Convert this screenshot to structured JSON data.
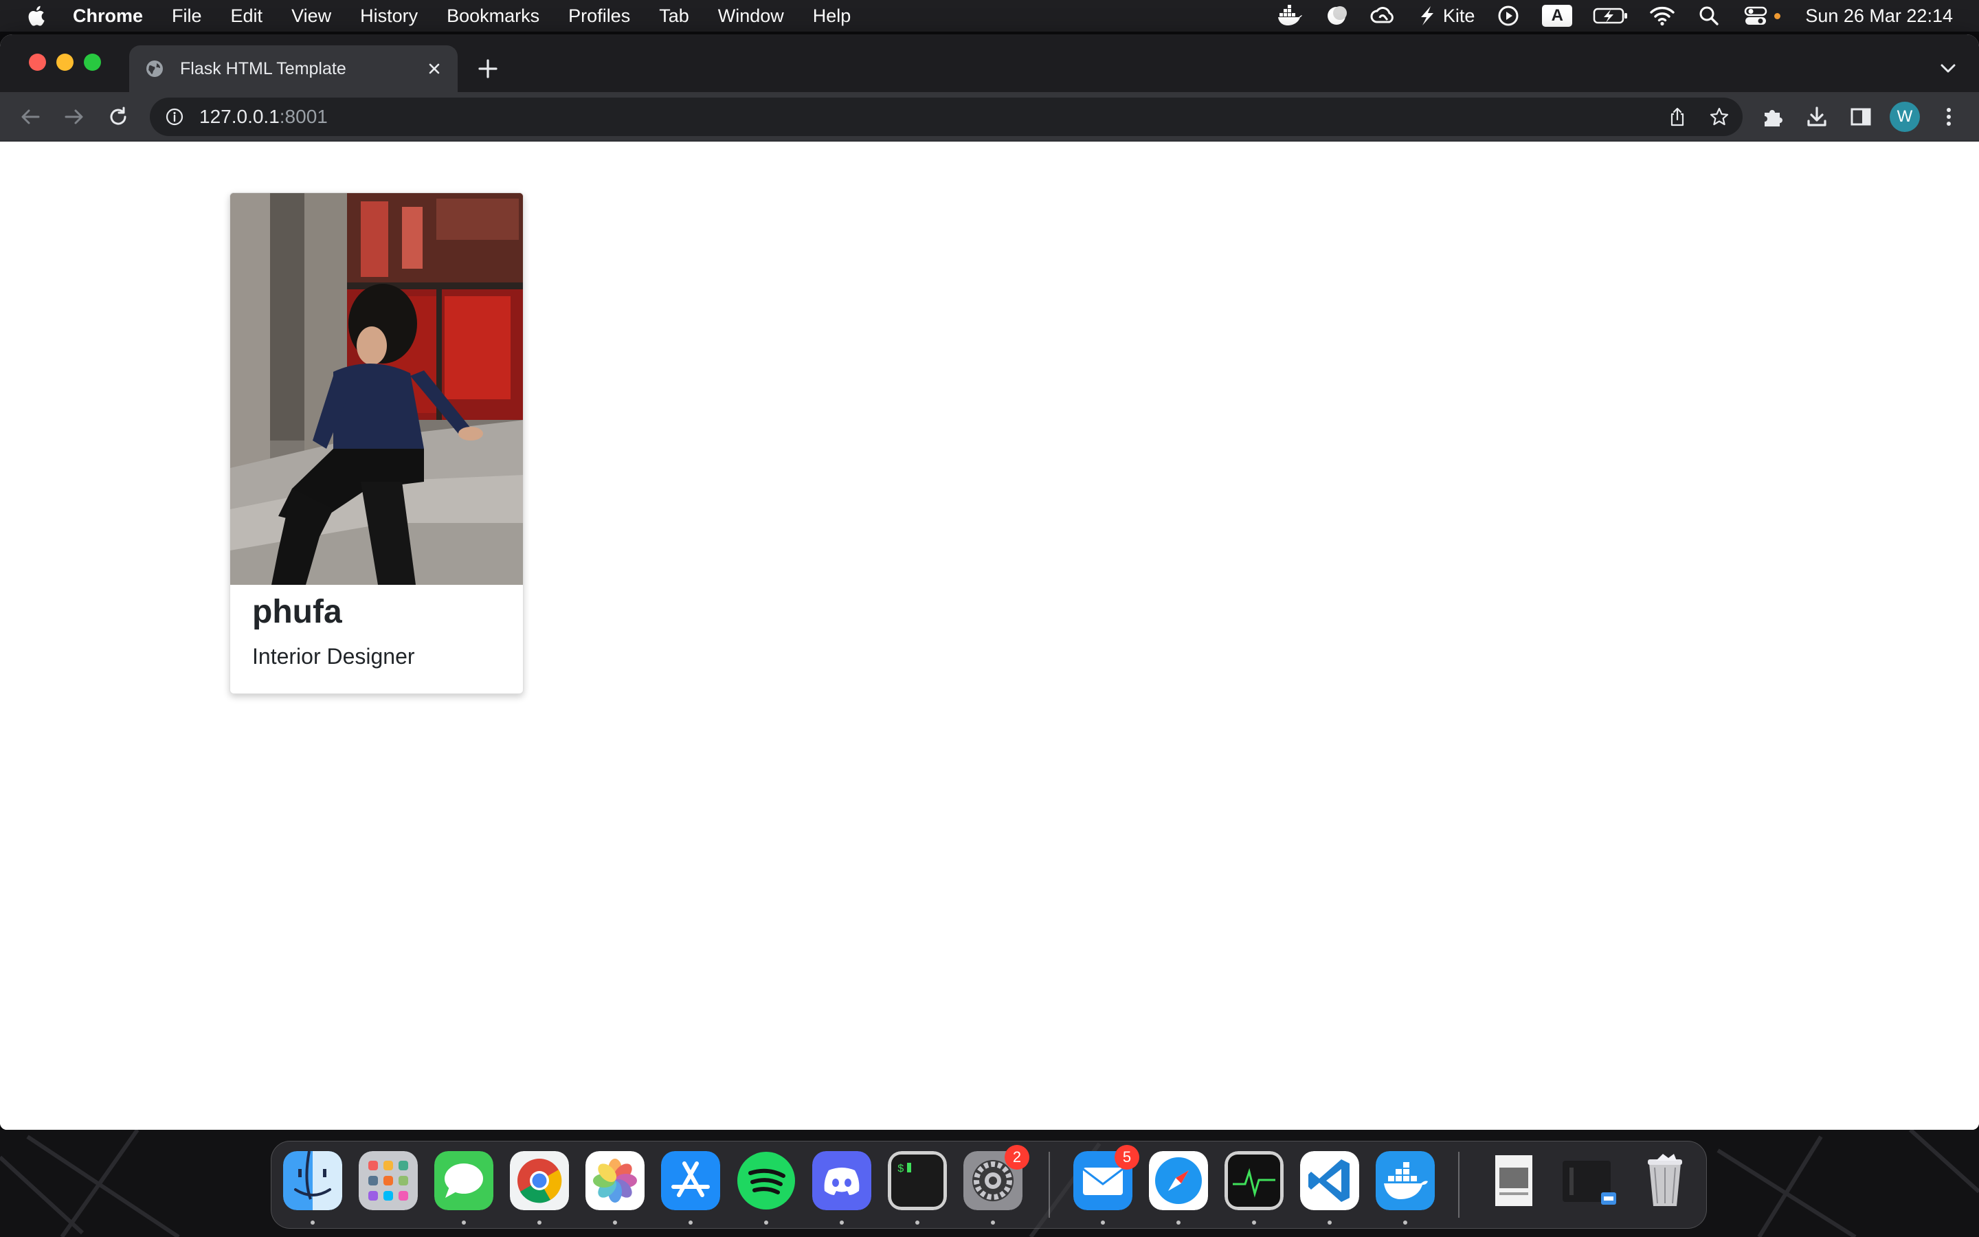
{
  "menubar": {
    "app_name": "Chrome",
    "menus": [
      "File",
      "Edit",
      "View",
      "History",
      "Bookmarks",
      "Profiles",
      "Tab",
      "Window",
      "Help"
    ],
    "status_items": [
      "docker-icon",
      "moon-icon",
      "creative-cloud-icon",
      "kite-icon",
      "play-icon",
      "input-source-icon",
      "battery-charging-icon",
      "wifi-icon",
      "spotlight-icon",
      "control-center-icon"
    ],
    "kite_label": "Kite",
    "input_source_label": "A",
    "clock": "Sun 26 Mar  22:14"
  },
  "browser": {
    "tab_title": "Flask HTML Template",
    "url_host": "127.0.0.1",
    "url_port": ":8001",
    "profile_initial": "W",
    "accent_color": "#2a8fa3"
  },
  "page": {
    "card": {
      "name": "phufa",
      "role": "Interior Designer",
      "photo_alt": "photo"
    }
  },
  "dock": {
    "apps": [
      "Finder",
      "Launchpad",
      "Messages",
      "Chrome",
      "Photos",
      "App Store",
      "Spotify",
      "Discord",
      "Terminal",
      "System Preferences",
      "Mail",
      "Safari",
      "Activity Monitor",
      "VS Code",
      "Docker",
      "Preview",
      "Downloads",
      "Trash"
    ],
    "badges": {
      "system_preferences": "2",
      "mail": "5"
    }
  }
}
